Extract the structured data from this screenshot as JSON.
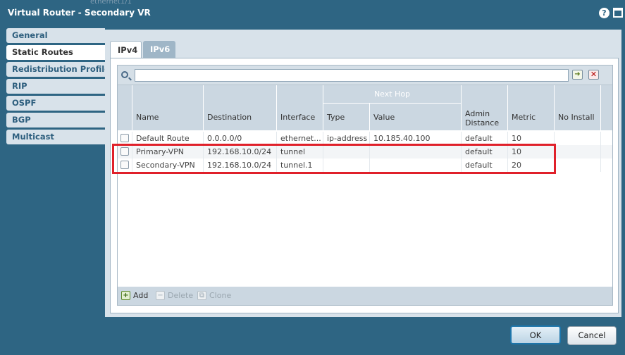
{
  "window": {
    "title": "Virtual Router - Secondary VR",
    "ghost_text": "ethernet1/1",
    "help_glyph": "?"
  },
  "sidebar": {
    "items": [
      {
        "label": "General"
      },
      {
        "label": "Static Routes"
      },
      {
        "label": "Redistribution Profiles"
      },
      {
        "label": "RIP"
      },
      {
        "label": "OSPF"
      },
      {
        "label": "BGP"
      },
      {
        "label": "Multicast"
      }
    ],
    "active": "Static Routes"
  },
  "tabs": [
    {
      "label": "IPv4"
    },
    {
      "label": "IPv6"
    }
  ],
  "search": {
    "value": "",
    "placeholder": ""
  },
  "table": {
    "group_header": "Next Hop",
    "columns": {
      "name": "Name",
      "destination": "Destination",
      "interface": "Interface",
      "type": "Type",
      "value": "Value",
      "admin_distance": "Admin Distance",
      "metric": "Metric",
      "no_install": "No Install"
    },
    "rows": [
      {
        "name": "Default Route",
        "destination": "0.0.0.0/0",
        "interface": "ethernet...",
        "type": "ip-address",
        "value": "10.185.40.100",
        "admin_distance": "default",
        "metric": "10",
        "no_install": ""
      },
      {
        "name": "Primary-VPN",
        "destination": "192.168.10.0/24",
        "interface": "tunnel",
        "type": "",
        "value": "",
        "admin_distance": "default",
        "metric": "10",
        "no_install": ""
      },
      {
        "name": "Secondary-VPN",
        "destination": "192.168.10.0/24",
        "interface": "tunnel.1",
        "type": "",
        "value": "",
        "admin_distance": "default",
        "metric": "20",
        "no_install": ""
      }
    ]
  },
  "footer": {
    "add": "Add",
    "delete": "Delete",
    "clone": "Clone"
  },
  "buttons": {
    "ok": "OK",
    "cancel": "Cancel"
  },
  "colors": {
    "titlebar": "#2e6583",
    "panel": "#d8e2ea",
    "highlight": "#e0202a"
  },
  "icons": {
    "search": "search-icon",
    "apply_filter": "arrow-right-icon",
    "clear_filter": "close-icon",
    "help": "help-icon",
    "maximize": "maximize-icon"
  }
}
